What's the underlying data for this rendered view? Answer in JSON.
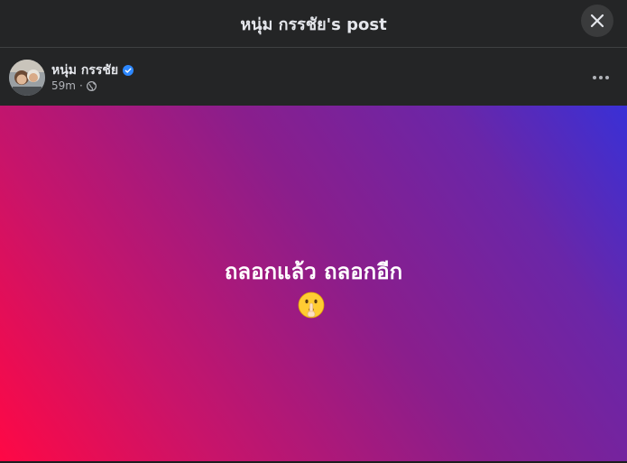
{
  "dialog": {
    "title": "หนุ่ม กรรชัย's post"
  },
  "post": {
    "author": "หนุ่ม กรรชัย",
    "time": "59m",
    "separator": "·",
    "text": "ถลอกแล้ว ถลอกอีก",
    "emoji": "shushing-face-emoji",
    "background_colors": [
      "#ff0845",
      "#8a1e8c",
      "#3930d6"
    ]
  },
  "icons": {
    "close": "close-icon",
    "verified": "verified-badge-icon",
    "privacy": "globe-icon",
    "more": "more-options-icon"
  }
}
